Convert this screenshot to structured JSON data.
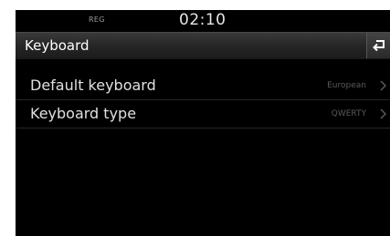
{
  "status_bar": {
    "reg_label": "REG",
    "time": "02:10"
  },
  "header": {
    "title": "Keyboard",
    "back_icon": "back-arrow-icon"
  },
  "settings": {
    "items": [
      {
        "label": "Default keyboard",
        "value": "European",
        "icon": "chevron-right-icon"
      },
      {
        "label": "Keyboard type",
        "value": "QWERTY",
        "icon": "chevron-right-icon"
      }
    ]
  },
  "colors": {
    "background": "#000000",
    "text": "#e0e0e0",
    "value_text": "#5a5a5a"
  }
}
